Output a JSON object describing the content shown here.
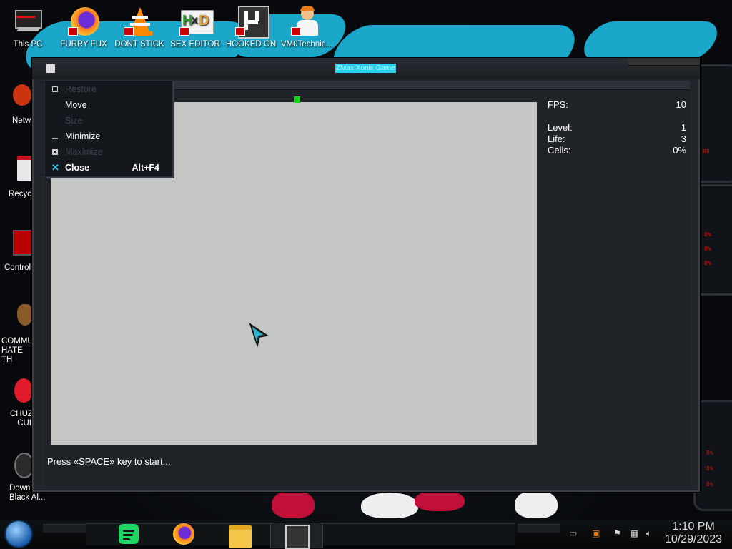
{
  "desktop": {
    "icons_row": [
      {
        "label": "This PC",
        "icon": "this-pc-icon"
      },
      {
        "label": "FURRY FUX",
        "icon": "firefox-icon"
      },
      {
        "label": "DONT STICK THIS IN YO...",
        "icon": "vlc-icon"
      },
      {
        "label": "SEX EDITOR",
        "icon": "hxd-icon"
      },
      {
        "label": "HOOKED ON XONIX",
        "icon": "xonix-icon"
      },
      {
        "label": "VM0Technic...",
        "icon": "doctor-icon"
      }
    ],
    "icons_column": [
      {
        "label": "Netw",
        "icon": "network-icon"
      },
      {
        "label": "Recycl",
        "icon": "recycle-bin-icon"
      },
      {
        "label": "Control",
        "icon": "control-panel-icon"
      },
      {
        "label": "COMMU HATE TH",
        "icon": "money-bag-icon"
      },
      {
        "label": "CHUZ CUI",
        "icon": "red-creature-icon"
      },
      {
        "label": "Downl Black Al...",
        "icon": "download-icon"
      }
    ]
  },
  "window": {
    "title": "ZMax Xonix Game",
    "sysmenu": [
      {
        "label": "Restore",
        "enabled": false,
        "icon": "restore-icon",
        "accel": ""
      },
      {
        "label": "Move",
        "enabled": true,
        "icon": "",
        "accel": ""
      },
      {
        "label": "Size",
        "enabled": false,
        "icon": "",
        "accel": ""
      },
      {
        "label": "Minimize",
        "enabled": true,
        "icon": "minimize-icon",
        "accel": ""
      },
      {
        "label": "Maximize",
        "enabled": false,
        "icon": "maximize-icon",
        "accel": ""
      },
      {
        "label": "Close",
        "enabled": true,
        "icon": "close-icon",
        "accel": "Alt+F4",
        "bold": true
      }
    ],
    "stats": {
      "fps_label": "FPS:",
      "fps_value": "10",
      "level_label": "Level:",
      "level_value": "1",
      "life_label": "Life:",
      "life_value": "3",
      "cells_label": "Cells:",
      "cells_value": "0%"
    },
    "prompt": "Press «SPACE» key to start...",
    "playfield_color": "#c4c6c4",
    "marker_color": "#15d21a"
  },
  "taskbar": {
    "apps": [
      {
        "name": "spotify",
        "icon": "spotify-icon"
      },
      {
        "name": "firefox",
        "icon": "firefox-icon"
      },
      {
        "name": "file-explorer",
        "icon": "folder-icon"
      },
      {
        "name": "xonix",
        "icon": "xonix-icon",
        "active": true
      }
    ],
    "clock": {
      "time": "1:10 PM",
      "date": "10/29/2023"
    }
  },
  "colors": {
    "accent": "#1aa7c9",
    "title_highlight": "#2bd0ee"
  }
}
